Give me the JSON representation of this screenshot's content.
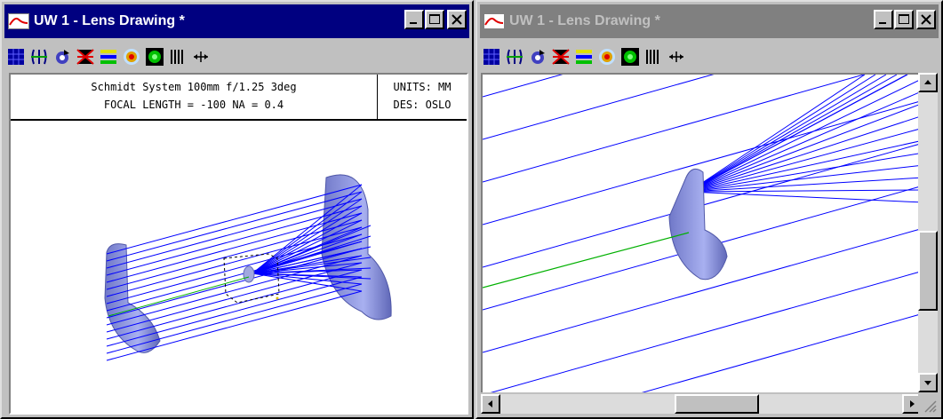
{
  "windows": [
    {
      "title": "UW 1 - Lens Drawing *",
      "active": true,
      "header": {
        "line1": "Schmidt System 100mm f/1.25 3deg",
        "line2": "FOCAL LENGTH = -100   NA = 0.4",
        "units": "UNITS: MM",
        "designer": "DES: OSLO"
      }
    },
    {
      "title": "UW 1 - Lens Drawing *",
      "active": false
    }
  ],
  "toolbar_icons": [
    "grid-icon",
    "lens-align-icon",
    "rotate-icon",
    "ray-fan-icon",
    "spot-rows-icon",
    "spot-target-icon",
    "circle-green-icon",
    "vertical-lines-icon",
    "pan-arrows-icon"
  ],
  "colors": {
    "active_title": "#000080",
    "inactive_title": "#808080",
    "ray_blue": "#0000ff",
    "ray_green": "#00b000",
    "lens": "#8c94d8"
  }
}
